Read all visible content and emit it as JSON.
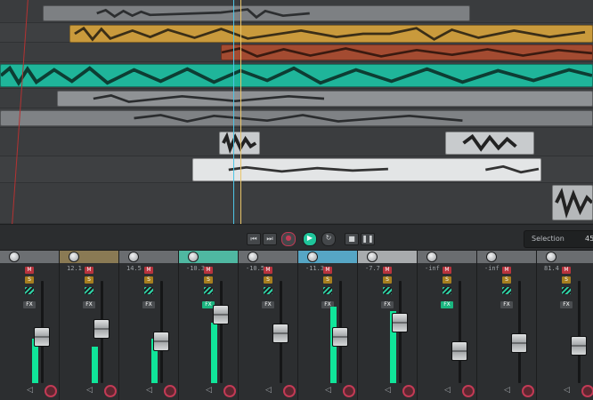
{
  "transport": {
    "buttons": [
      {
        "name": "go-to-start",
        "glyph": "⏮"
      },
      {
        "name": "go-to-end",
        "glyph": "⏭"
      },
      {
        "name": "record",
        "glyph": "●"
      },
      {
        "name": "play",
        "glyph": "▶"
      },
      {
        "name": "loop",
        "glyph": "↻"
      },
      {
        "name": "stop",
        "glyph": "■"
      },
      {
        "name": "pause",
        "glyph": "❚❚"
      }
    ],
    "selection_label": "Selection",
    "selection_value": "45"
  },
  "mixer": {
    "channels": [
      {
        "db": "",
        "head_color": "#6c6f72",
        "meter": 0.55,
        "fader": 0.45
      },
      {
        "db": "12.1",
        "head_color": "#8a7a54",
        "meter": 0.45,
        "fader": 0.55
      },
      {
        "db": "14.5",
        "head_color": "#6a6d70",
        "meter": 0.55,
        "fader": 0.4
      },
      {
        "db": "-10.3",
        "head_color": "#4fb8a1",
        "meter": 0.75,
        "fader": 0.72
      },
      {
        "db": "-10.5",
        "head_color": "#6a6d70",
        "meter": 0.0,
        "fader": 0.5
      },
      {
        "db": "-11.3",
        "head_color": "#56a6c5",
        "meter": 0.95,
        "fader": 0.45
      },
      {
        "db": "-7.7",
        "head_color": "#a8abad",
        "meter": 0.9,
        "fader": 0.62
      },
      {
        "db": "-inf",
        "head_color": "#6a6d70",
        "meter": 0.0,
        "fader": 0.28
      },
      {
        "db": "-inf",
        "head_color": "#6a6d70",
        "meter": 0.0,
        "fader": 0.38
      },
      {
        "db": "81.4",
        "head_color": "#6a6d70",
        "meter": 0.0,
        "fader": 0.35
      }
    ],
    "labels": {
      "mute": "M",
      "solo": "S",
      "fx": "FX"
    }
  },
  "colors": {
    "teal": "#1fb59a",
    "amber": "#c99a3c",
    "rust": "#a34b31",
    "meter_green": "#10e59a",
    "record_red": "#c23a55",
    "play_green": "#1fc49a"
  }
}
